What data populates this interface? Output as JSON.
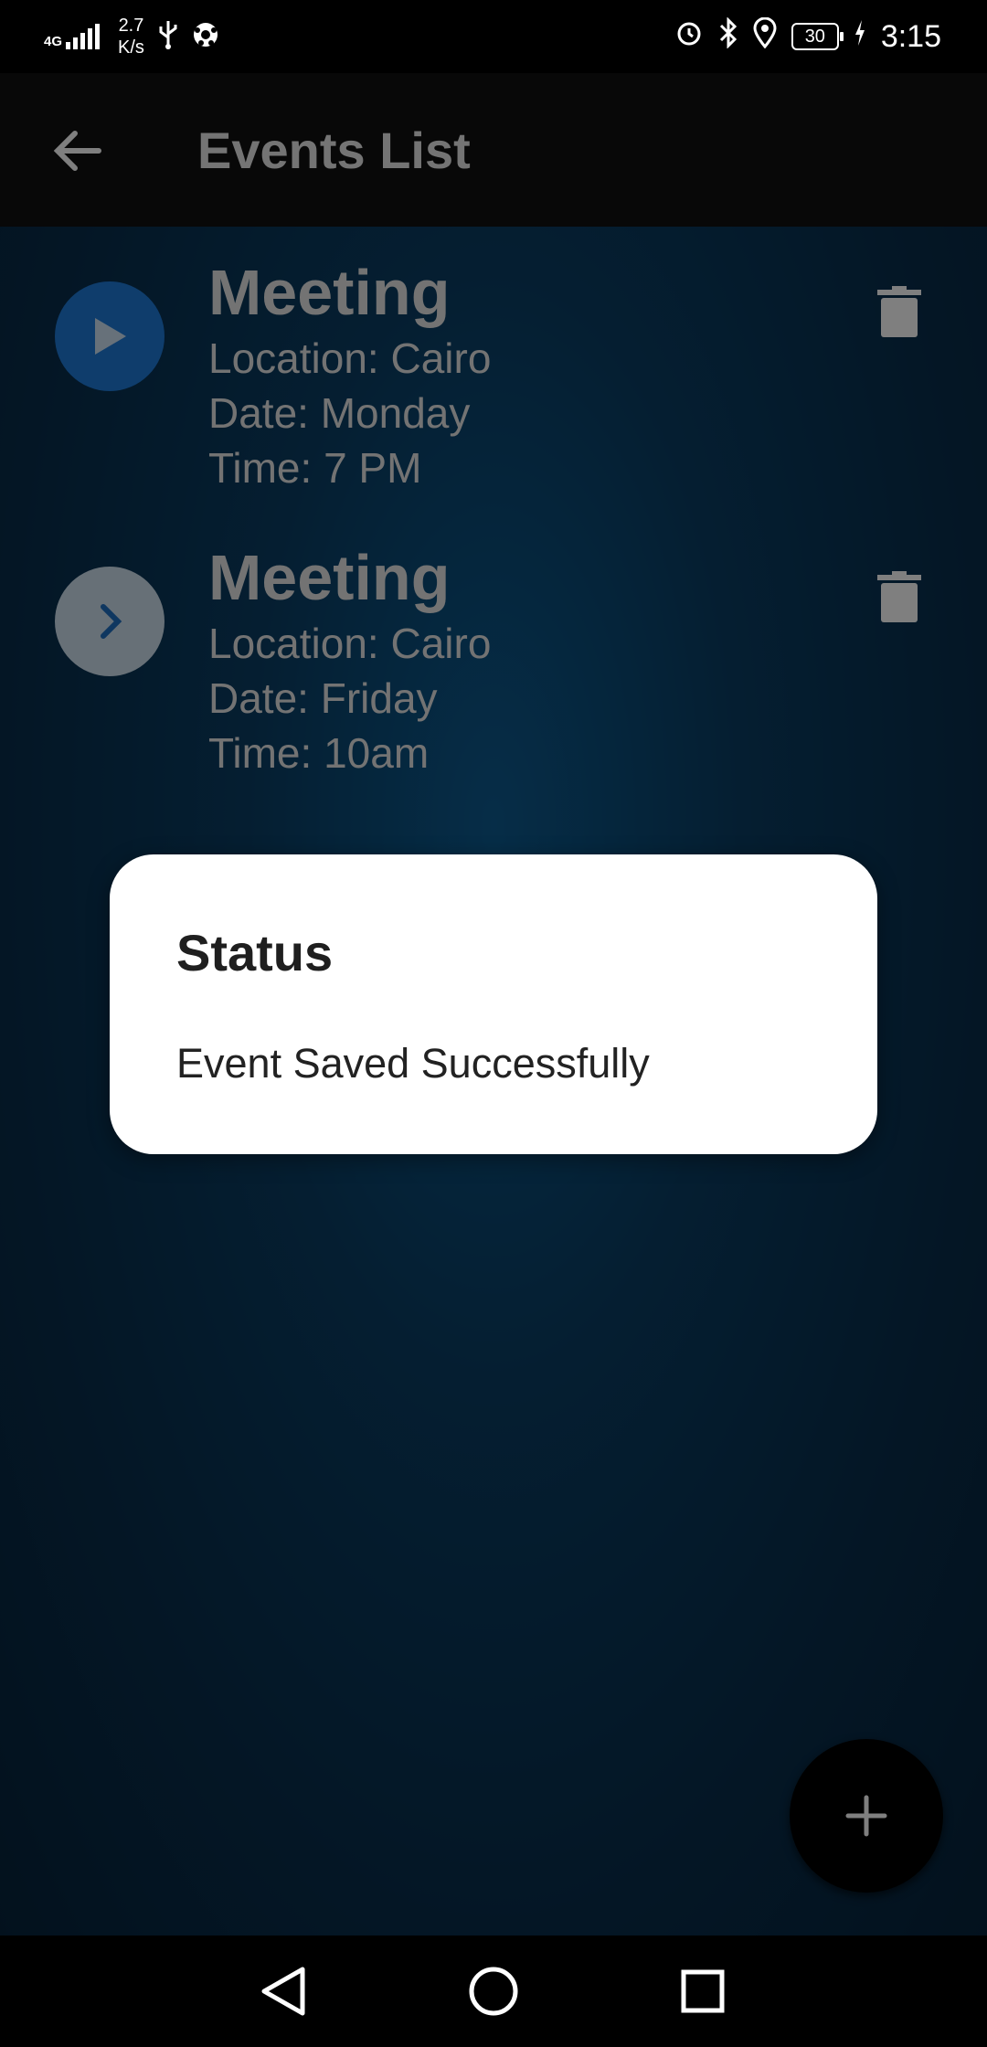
{
  "status_bar": {
    "network": "4G",
    "speed_value": "2.7",
    "speed_unit": "K/s",
    "battery": "30",
    "time": "3:15",
    "icons": [
      "signal-icon",
      "usb-icon",
      "ball-icon",
      "alarm-icon",
      "bluetooth-icon",
      "location-icon",
      "battery-icon",
      "charging-icon"
    ]
  },
  "app_bar": {
    "title": "Events List",
    "back_icon": "arrow-left-icon"
  },
  "events": [
    {
      "title": "Meeting",
      "location": "Location: Cairo",
      "date": "Date: Monday",
      "time": "Time: 7 PM",
      "action_icon": "play-icon",
      "delete_icon": "trash-icon"
    },
    {
      "title": "Meeting",
      "location": "Location: Cairo",
      "date": "Date: Friday",
      "time": "Time: 10am",
      "action_icon": "chevron-right-icon",
      "delete_icon": "trash-icon"
    }
  ],
  "dialog": {
    "title": "Status",
    "message": "Event Saved Successfully"
  },
  "fab": {
    "icon": "plus-icon"
  },
  "nav_bar": {
    "icons": [
      "back-triangle-icon",
      "home-circle-icon",
      "recents-square-icon"
    ]
  },
  "colors": {
    "background": "#082d4b",
    "play_button": "#1e7bd8",
    "next_button": "#cfe0ee",
    "dialog": "#ffffff"
  }
}
